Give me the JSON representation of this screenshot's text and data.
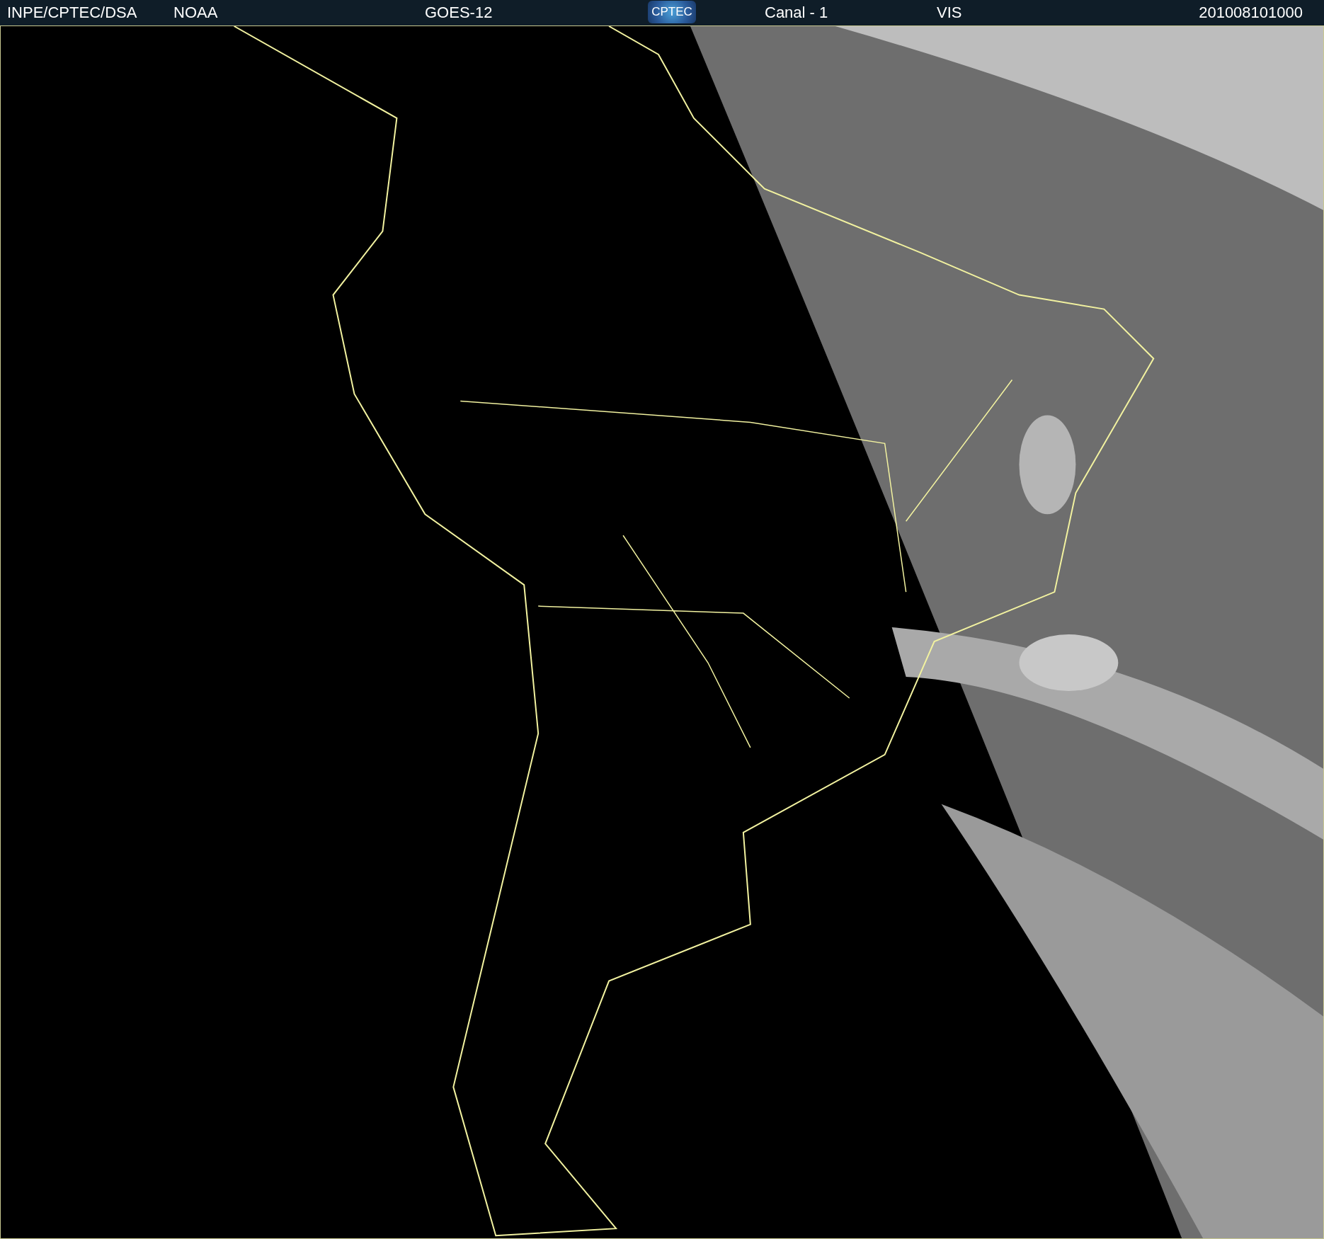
{
  "header": {
    "items": [
      {
        "kind": "text",
        "text": "INPE/CPTEC/DSA"
      },
      {
        "kind": "text",
        "text": "NOAA"
      },
      {
        "kind": "text",
        "text": "GOES-12"
      },
      {
        "kind": "logo",
        "text": "CPTEC"
      },
      {
        "kind": "text",
        "text": "Canal - 1"
      },
      {
        "kind": "text",
        "text": "VIS"
      },
      {
        "kind": "text",
        "text": "201008101000"
      }
    ]
  }
}
